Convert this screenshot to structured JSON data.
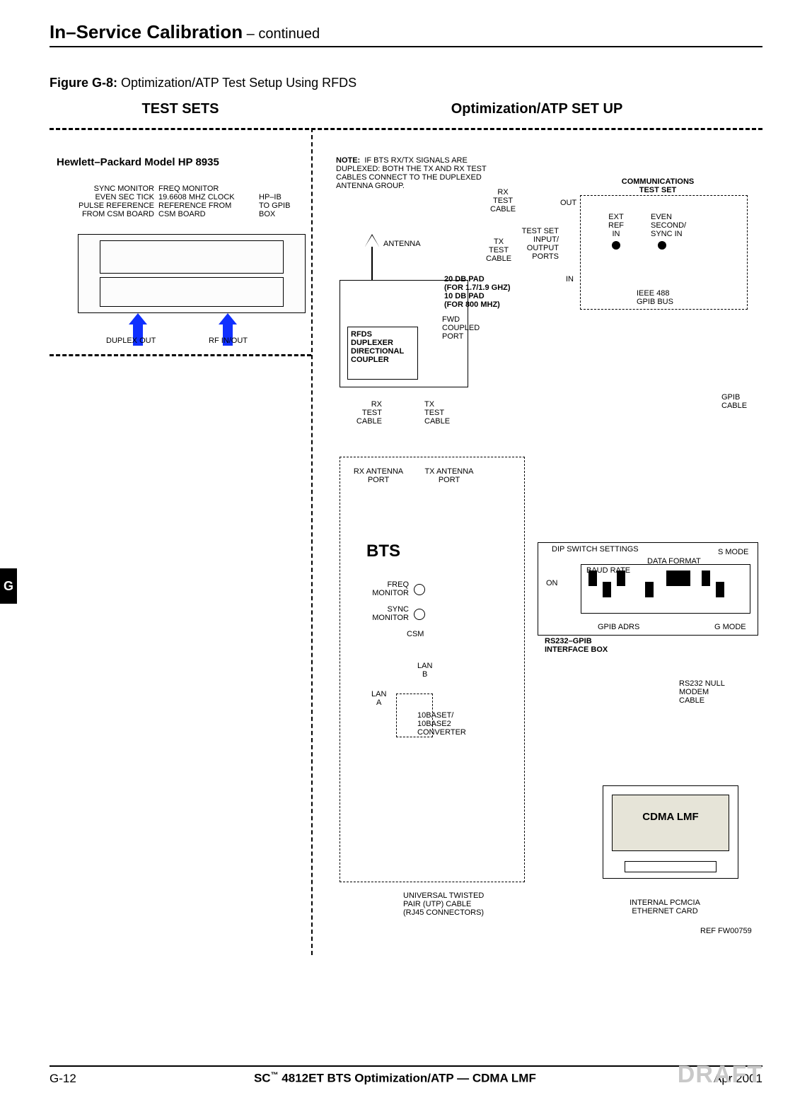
{
  "header": {
    "title": "In–Service Calibration",
    "cont": " – continued"
  },
  "figure": {
    "label": "Figure G-8:",
    "caption": " Optimization/ATP Test Setup Using RFDS"
  },
  "sections": {
    "left": "TEST SETS",
    "right": "Optimization/ATP SET UP"
  },
  "hp": {
    "title": "Hewlett–Packard Model HP 8935",
    "sync": "SYNC MONITOR\nEVEN SEC TICK\nPULSE REFERENCE\nFROM CSM BOARD",
    "freq": "FREQ MONITOR\n19.6608 MHZ CLOCK\nREFERENCE FROM\nCSM BOARD",
    "hpib": "HP–IB\nTO GPIB\nBOX",
    "duplex": "DUPLEX OUT",
    "rf": "RF IN/OUT"
  },
  "right": {
    "note": "NOTE:  IF BTS RX/TX SIGNALS ARE\nDUPLEXED: BOTH THE TX AND RX TEST\nCABLES CONNECT TO THE DUPLEXED\nANTENNA GROUP.",
    "rx_test_cable": "RX\nTEST\nCABLE",
    "tx_test_cable": "TX\nTEST\nCABLE",
    "out": "OUT",
    "in": "IN",
    "test_set_ports": "TEST SET\nINPUT/\nOUTPUT\nPORTS",
    "comm_test_set": "COMMUNICATIONS\nTEST SET",
    "ext_ref": "EXT\nREF\nIN",
    "even_sec": "EVEN\nSECOND/\nSYNC IN",
    "ieee": "IEEE 488\nGPIB BUS",
    "pad": "20 DB PAD\n(FOR 1.7/1.9 GHZ)\n10 DB PAD\n(FOR 800 MHZ)",
    "fwd": "FWD\nCOUPLED\nPORT",
    "coupler": "RFDS\nDUPLEXER\nDIRECTIONAL\nCOUPLER",
    "antenna": "ANTENNA",
    "gpib_cable": "GPIB\nCABLE",
    "rx_test_cable2": "RX\nTEST\nCABLE",
    "tx_test_cable2": "TX\nTEST\nCABLE",
    "rx_ant": "RX ANTENNA\nPORT",
    "tx_ant": "TX ANTENNA\nPORT",
    "bts": "BTS",
    "freq_mon": "FREQ\nMONITOR",
    "sync_mon": "SYNC\nMONITOR",
    "csm": "CSM",
    "lan_a": "LAN\nA",
    "lan_b": "LAN\nB",
    "conv": "10BASET/\n10BASE2\nCONVERTER",
    "utp": "UNIVERSAL TWISTED\nPAIR (UTP) CABLE\n(RJ45 CONNECTORS)",
    "pcmcia": "INTERNAL PCMCIA\nETHERNET CARD",
    "ref": "REF FW00759",
    "dip_title": "DIP SWITCH SETTINGS",
    "s_mode": "S MODE",
    "data_fmt": "DATA FORMAT",
    "baud": "BAUD RATE",
    "on": "ON",
    "gpib_adrs": "GPIB ADRS",
    "g_mode": "G MODE",
    "rs232_box": "RS232–GPIB\nINTERFACE BOX",
    "rs232_null": "RS232 NULL\nMODEM\nCABLE",
    "cdma": "CDMA\nLMF"
  },
  "tab": "G",
  "footer": {
    "left": "G-12",
    "center_pre": "SC",
    "center_tm": "™",
    "center_post": "4812ET BTS Optimization/ATP — CDMA LMF",
    "right": "Apr 2001",
    "draft": "DRAFT"
  }
}
